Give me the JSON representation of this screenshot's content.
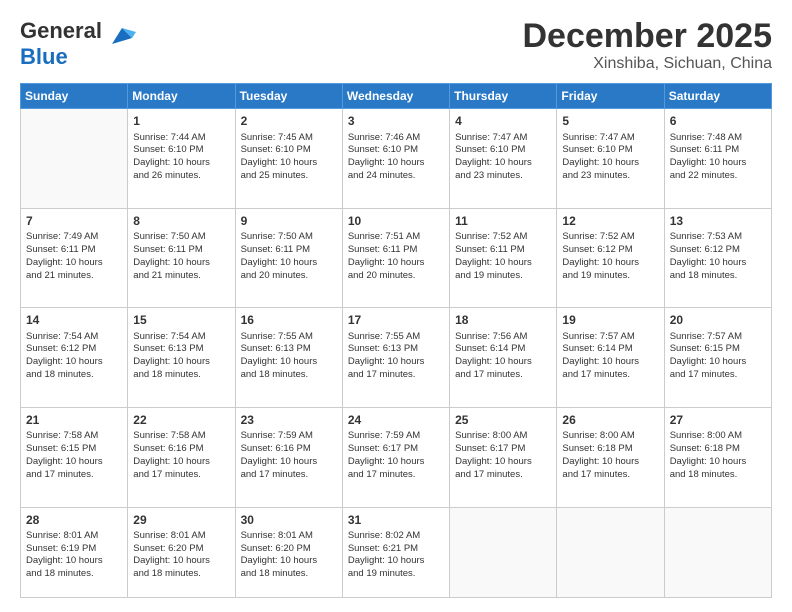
{
  "header": {
    "logo_general": "General",
    "logo_blue": "Blue",
    "month": "December 2025",
    "location": "Xinshiba, Sichuan, China"
  },
  "weekdays": [
    "Sunday",
    "Monday",
    "Tuesday",
    "Wednesday",
    "Thursday",
    "Friday",
    "Saturday"
  ],
  "weeks": [
    [
      {
        "day": "",
        "info": ""
      },
      {
        "day": "1",
        "info": "Sunrise: 7:44 AM\nSunset: 6:10 PM\nDaylight: 10 hours\nand 26 minutes."
      },
      {
        "day": "2",
        "info": "Sunrise: 7:45 AM\nSunset: 6:10 PM\nDaylight: 10 hours\nand 25 minutes."
      },
      {
        "day": "3",
        "info": "Sunrise: 7:46 AM\nSunset: 6:10 PM\nDaylight: 10 hours\nand 24 minutes."
      },
      {
        "day": "4",
        "info": "Sunrise: 7:47 AM\nSunset: 6:10 PM\nDaylight: 10 hours\nand 23 minutes."
      },
      {
        "day": "5",
        "info": "Sunrise: 7:47 AM\nSunset: 6:10 PM\nDaylight: 10 hours\nand 23 minutes."
      },
      {
        "day": "6",
        "info": "Sunrise: 7:48 AM\nSunset: 6:11 PM\nDaylight: 10 hours\nand 22 minutes."
      }
    ],
    [
      {
        "day": "7",
        "info": "Sunrise: 7:49 AM\nSunset: 6:11 PM\nDaylight: 10 hours\nand 21 minutes."
      },
      {
        "day": "8",
        "info": "Sunrise: 7:50 AM\nSunset: 6:11 PM\nDaylight: 10 hours\nand 21 minutes."
      },
      {
        "day": "9",
        "info": "Sunrise: 7:50 AM\nSunset: 6:11 PM\nDaylight: 10 hours\nand 20 minutes."
      },
      {
        "day": "10",
        "info": "Sunrise: 7:51 AM\nSunset: 6:11 PM\nDaylight: 10 hours\nand 20 minutes."
      },
      {
        "day": "11",
        "info": "Sunrise: 7:52 AM\nSunset: 6:11 PM\nDaylight: 10 hours\nand 19 minutes."
      },
      {
        "day": "12",
        "info": "Sunrise: 7:52 AM\nSunset: 6:12 PM\nDaylight: 10 hours\nand 19 minutes."
      },
      {
        "day": "13",
        "info": "Sunrise: 7:53 AM\nSunset: 6:12 PM\nDaylight: 10 hours\nand 18 minutes."
      }
    ],
    [
      {
        "day": "14",
        "info": "Sunrise: 7:54 AM\nSunset: 6:12 PM\nDaylight: 10 hours\nand 18 minutes."
      },
      {
        "day": "15",
        "info": "Sunrise: 7:54 AM\nSunset: 6:13 PM\nDaylight: 10 hours\nand 18 minutes."
      },
      {
        "day": "16",
        "info": "Sunrise: 7:55 AM\nSunset: 6:13 PM\nDaylight: 10 hours\nand 18 minutes."
      },
      {
        "day": "17",
        "info": "Sunrise: 7:55 AM\nSunset: 6:13 PM\nDaylight: 10 hours\nand 17 minutes."
      },
      {
        "day": "18",
        "info": "Sunrise: 7:56 AM\nSunset: 6:14 PM\nDaylight: 10 hours\nand 17 minutes."
      },
      {
        "day": "19",
        "info": "Sunrise: 7:57 AM\nSunset: 6:14 PM\nDaylight: 10 hours\nand 17 minutes."
      },
      {
        "day": "20",
        "info": "Sunrise: 7:57 AM\nSunset: 6:15 PM\nDaylight: 10 hours\nand 17 minutes."
      }
    ],
    [
      {
        "day": "21",
        "info": "Sunrise: 7:58 AM\nSunset: 6:15 PM\nDaylight: 10 hours\nand 17 minutes."
      },
      {
        "day": "22",
        "info": "Sunrise: 7:58 AM\nSunset: 6:16 PM\nDaylight: 10 hours\nand 17 minutes."
      },
      {
        "day": "23",
        "info": "Sunrise: 7:59 AM\nSunset: 6:16 PM\nDaylight: 10 hours\nand 17 minutes."
      },
      {
        "day": "24",
        "info": "Sunrise: 7:59 AM\nSunset: 6:17 PM\nDaylight: 10 hours\nand 17 minutes."
      },
      {
        "day": "25",
        "info": "Sunrise: 8:00 AM\nSunset: 6:17 PM\nDaylight: 10 hours\nand 17 minutes."
      },
      {
        "day": "26",
        "info": "Sunrise: 8:00 AM\nSunset: 6:18 PM\nDaylight: 10 hours\nand 17 minutes."
      },
      {
        "day": "27",
        "info": "Sunrise: 8:00 AM\nSunset: 6:18 PM\nDaylight: 10 hours\nand 18 minutes."
      }
    ],
    [
      {
        "day": "28",
        "info": "Sunrise: 8:01 AM\nSunset: 6:19 PM\nDaylight: 10 hours\nand 18 minutes."
      },
      {
        "day": "29",
        "info": "Sunrise: 8:01 AM\nSunset: 6:20 PM\nDaylight: 10 hours\nand 18 minutes."
      },
      {
        "day": "30",
        "info": "Sunrise: 8:01 AM\nSunset: 6:20 PM\nDaylight: 10 hours\nand 18 minutes."
      },
      {
        "day": "31",
        "info": "Sunrise: 8:02 AM\nSunset: 6:21 PM\nDaylight: 10 hours\nand 19 minutes."
      },
      {
        "day": "",
        "info": ""
      },
      {
        "day": "",
        "info": ""
      },
      {
        "day": "",
        "info": ""
      }
    ]
  ]
}
